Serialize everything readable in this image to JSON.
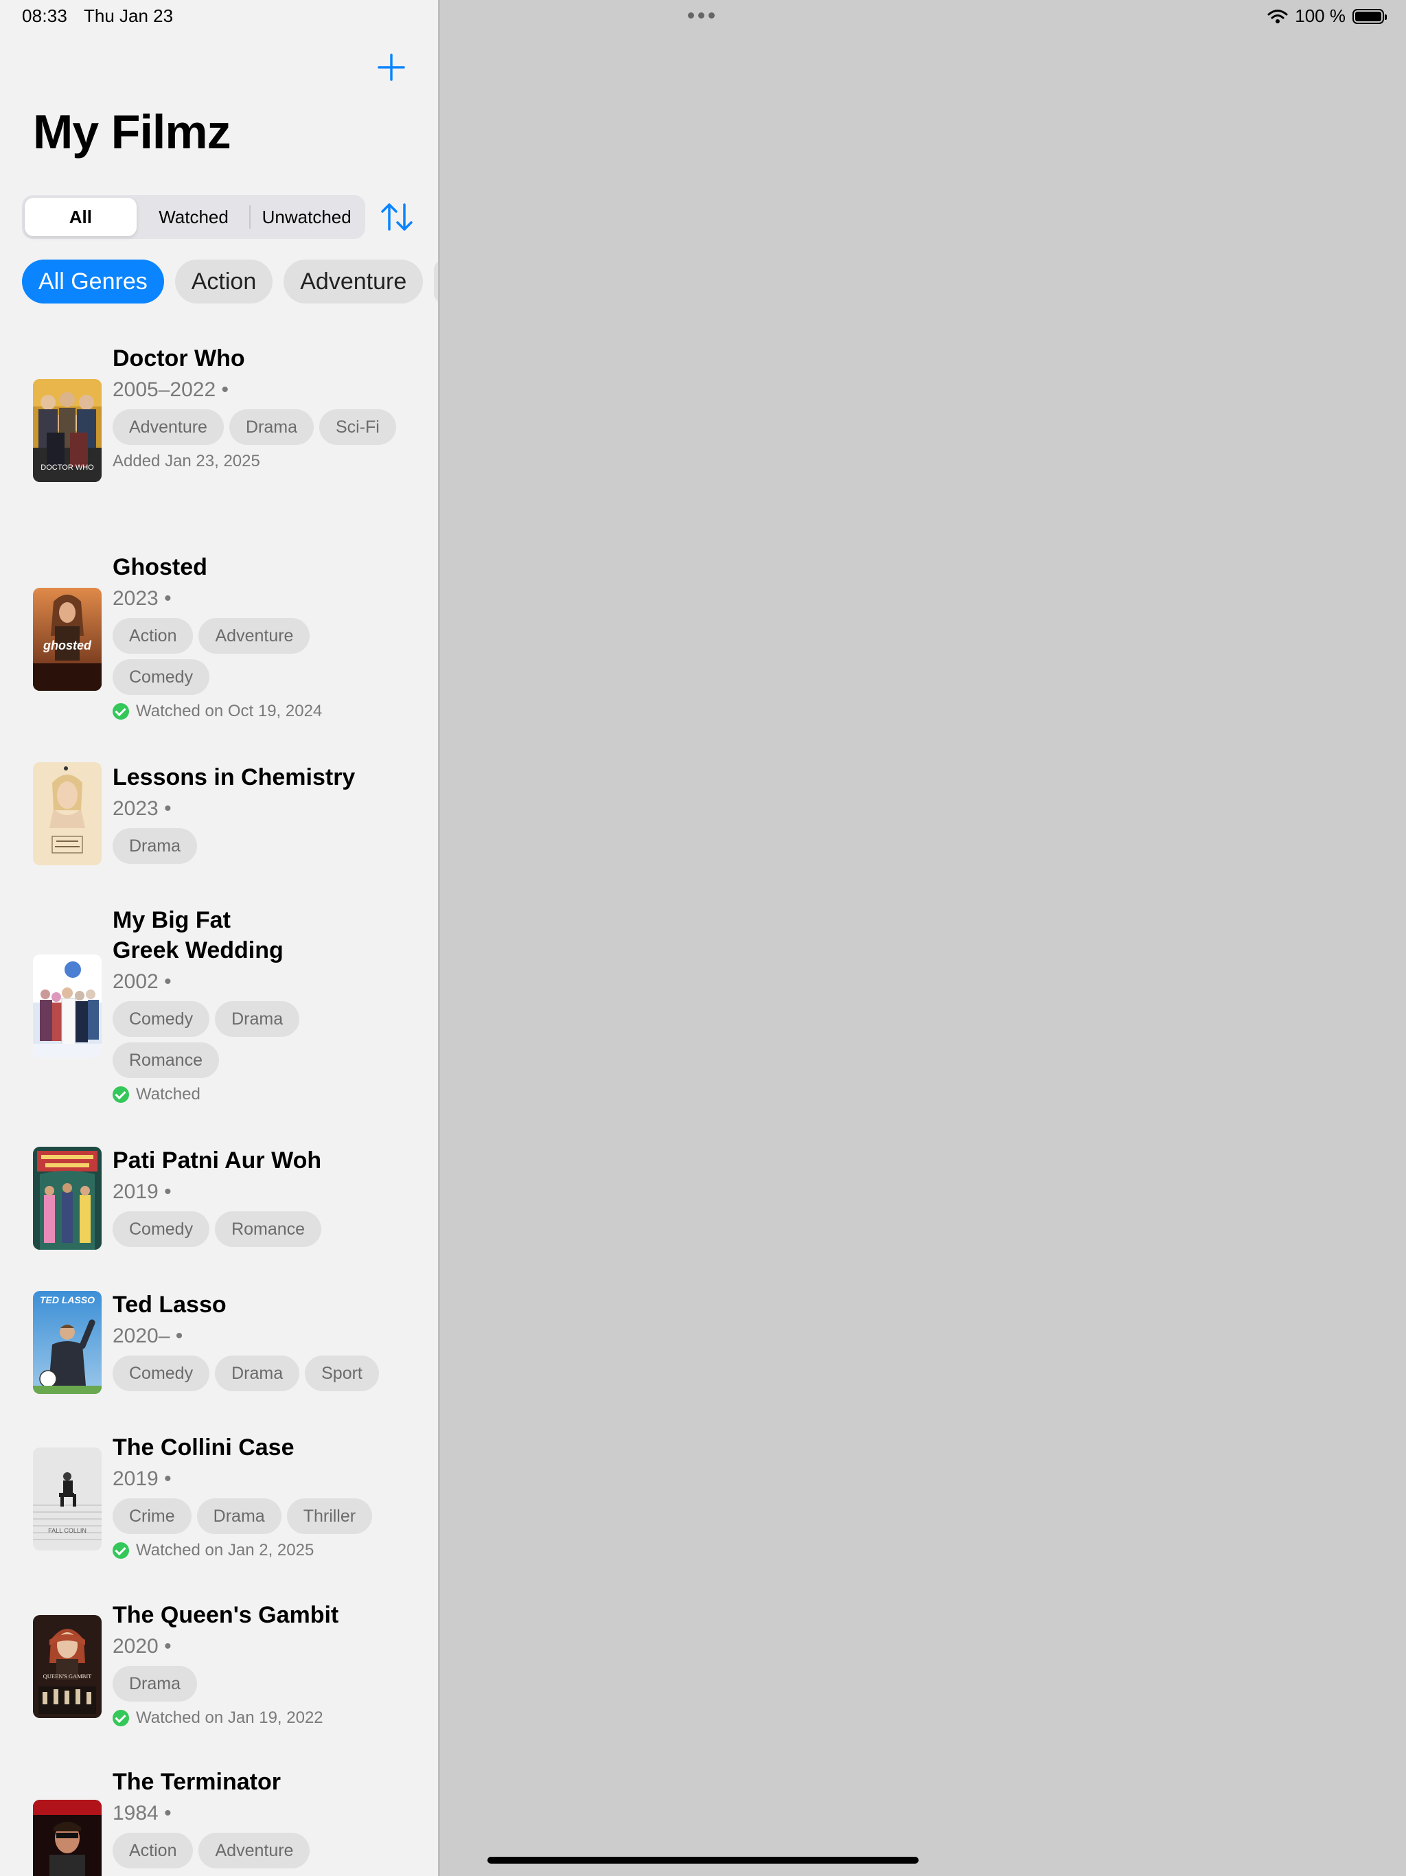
{
  "status": {
    "time": "08:33",
    "date": "Thu Jan 23",
    "battery": "100 %"
  },
  "header": {
    "title": "My Filmz"
  },
  "filter": {
    "segments": [
      "All",
      "Watched",
      "Unwatched"
    ],
    "selected": "All"
  },
  "genres": {
    "items": [
      "All Genres",
      "Action",
      "Adventure"
    ],
    "selected": "All Genres"
  },
  "films": [
    {
      "title": "Doctor Who",
      "years": "2005–2022 •",
      "tags": [
        "Adventure",
        "Drama",
        "Sci-Fi"
      ],
      "status": "Added Jan 23, 2025",
      "watched": false
    },
    {
      "title": "Ghosted",
      "years": "2023 •",
      "tags": [
        "Action",
        "Adventure",
        "Comedy"
      ],
      "status": "Watched on Oct 19, 2024",
      "watched": true
    },
    {
      "title": "Lessons in Chemistry",
      "years": "2023 •",
      "tags": [
        "Drama"
      ],
      "status": "",
      "watched": false
    },
    {
      "title": "My Big Fat Greek Wedding",
      "title_lines": [
        "My Big Fat",
        "Greek Wedding"
      ],
      "years": "2002 •",
      "tags": [
        "Comedy",
        "Drama",
        "Romance"
      ],
      "status": "Watched",
      "watched": true
    },
    {
      "title": "Pati Patni Aur Woh",
      "years": "2019 •",
      "tags": [
        "Comedy",
        "Romance"
      ],
      "status": "",
      "watched": false
    },
    {
      "title": "Ted Lasso",
      "years": "2020– •",
      "tags": [
        "Comedy",
        "Drama",
        "Sport"
      ],
      "status": "",
      "watched": false
    },
    {
      "title": "The Collini Case",
      "years": "2019 •",
      "tags": [
        "Crime",
        "Drama",
        "Thriller"
      ],
      "status": "Watched on Jan 2, 2025",
      "watched": true
    },
    {
      "title": "The Queen's Gambit",
      "years": "2020 •",
      "tags": [
        "Drama"
      ],
      "status": "Watched on Jan 19, 2022",
      "watched": true
    },
    {
      "title": "The Terminator",
      "years": "1984 •",
      "tags": [
        "Action",
        "Adventure"
      ],
      "status": "",
      "watched": false
    }
  ],
  "poster_text": {
    "doctor_who": "DOCTOR WHO",
    "ghosted": "ghosted",
    "ted_lasso": "TED LASSO",
    "collini": "FALL COLLIN",
    "queens_gambit": "QUEEN'S GAMBIT"
  },
  "colors": {
    "accent": "#0a84ff",
    "watched_check": "#34c759",
    "sidebar_bg": "#f2f2f2",
    "detail_bg": "#cccccc"
  }
}
